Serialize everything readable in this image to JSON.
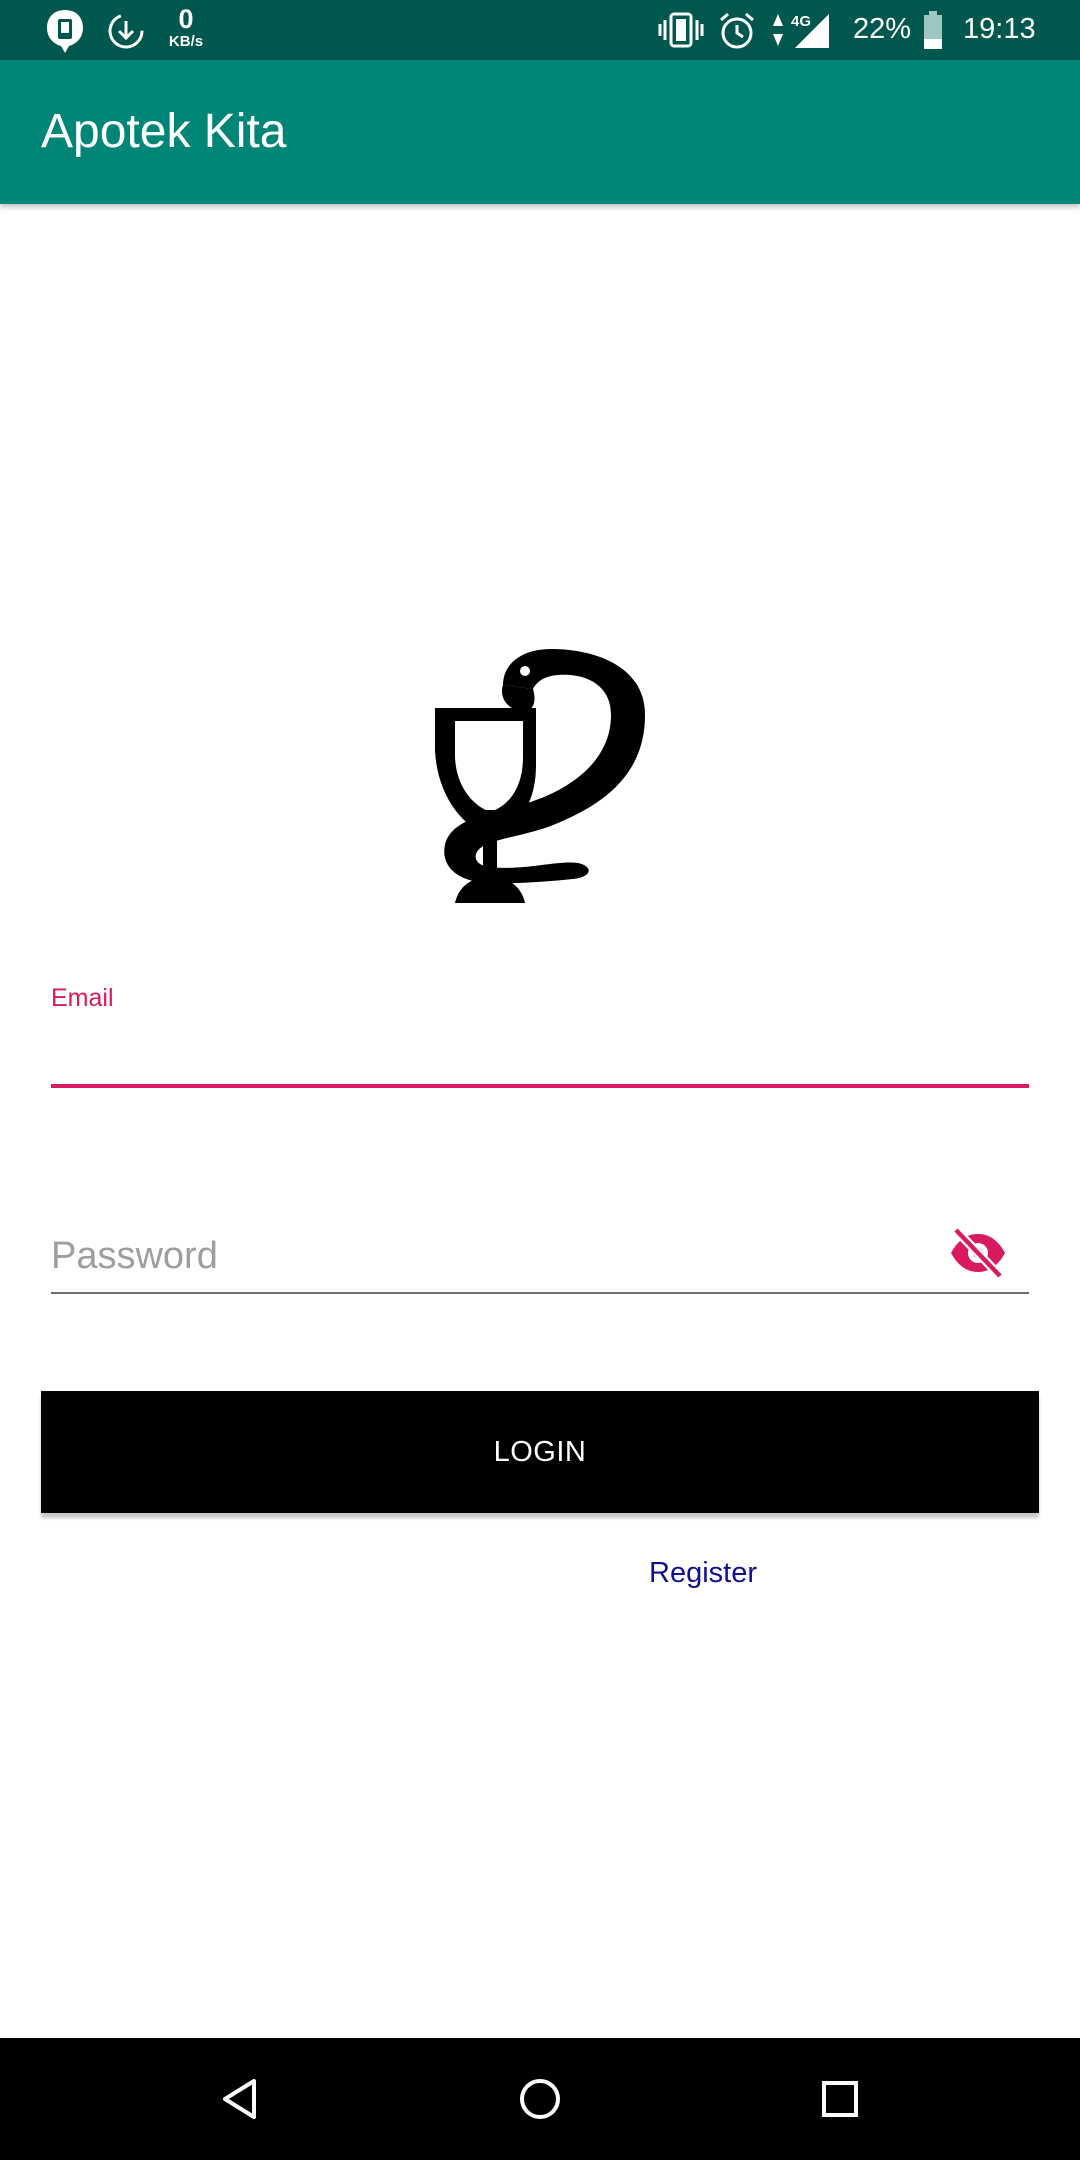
{
  "status_bar": {
    "net_speed_value": "0",
    "net_speed_unit": "KB/s",
    "network_type": "4G",
    "battery_percent": "22%",
    "time": "19:13",
    "icons": [
      "notification-icon",
      "download-icon",
      "vibrate-icon",
      "alarm-icon",
      "data-arrows-icon",
      "signal-icon",
      "battery-icon"
    ]
  },
  "app_bar": {
    "title": "Apotek Kita"
  },
  "logo": {
    "icon": "pharmacy-bowl-of-hygieia-icon"
  },
  "form": {
    "email": {
      "label": "Email",
      "value": "",
      "state": "focused"
    },
    "password": {
      "placeholder": "Password",
      "value": "",
      "toggle_icon": "visibility-off-icon"
    },
    "login_label": "LOGIN",
    "register_label": "Register"
  },
  "nav_bar": {
    "icons": [
      "back-icon",
      "home-icon",
      "recents-icon"
    ]
  },
  "colors": {
    "status_bar": "#00574d",
    "app_bar": "#008577",
    "accent": "#d81b60",
    "button": "#000000",
    "link": "#0f0f8f"
  }
}
